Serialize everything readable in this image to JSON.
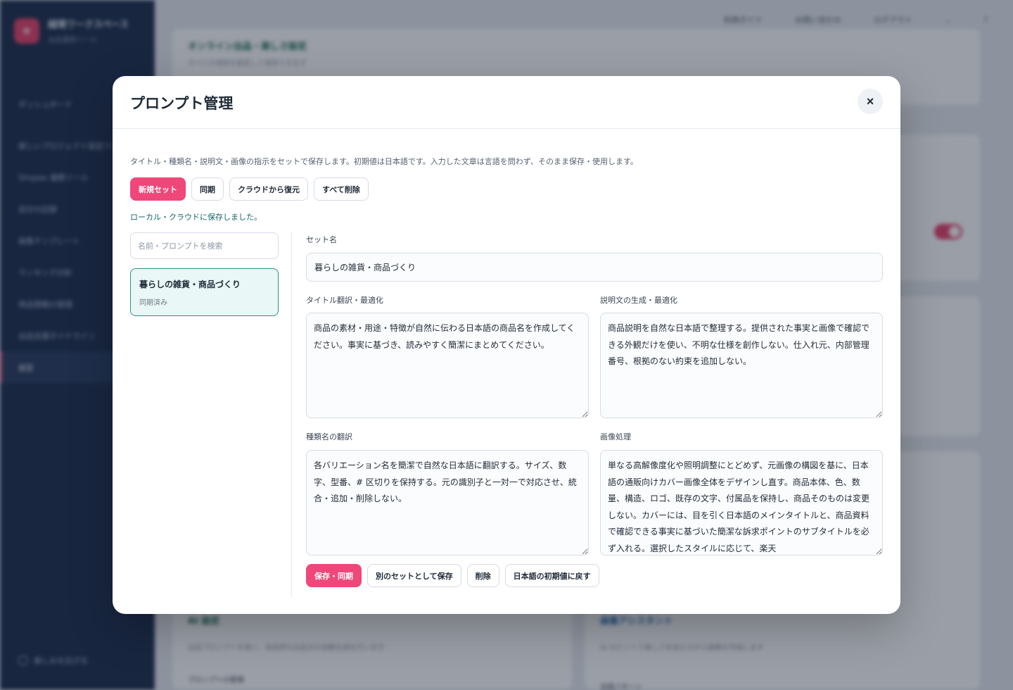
{
  "background": {
    "brand": {
      "logo": "e",
      "title": "越境ワークスペース",
      "subtitle": "出品運用ツール"
    },
    "nav": [
      "ダッシュボード",
      "楽しいプロジェクト設定ツール",
      "Shopee 連携ツール",
      "自分の記録",
      "画像テンプレート",
      "ランキング分析",
      "商品情報の管理",
      "出品支援ガイドライン",
      "設定"
    ],
    "nav_active_index": 8,
    "footer": "楽しみを広げる",
    "topbar": [
      "利用ガイド",
      "お問い合わせ",
      "ログアウト",
      "⌄",
      "?"
    ],
    "cards": [
      {
        "title": "オンライン出品・楽しさ設定",
        "subtitle": "すべての項目を設定して保存できます"
      },
      {
        "title": "AI 設定",
        "subtitle": "出品プロンプトを使い、高品質な出品文の自動生成を行います"
      },
      {
        "title": "画像アシスタント",
        "subtitle": "AI のヒントで楽しさを加えながら画像を作成します"
      }
    ],
    "extra_text": [
      "プロンプトの管理",
      "言語パターン"
    ]
  },
  "modal": {
    "title": "プロンプト管理",
    "close_icon": "×",
    "description": "タイトル・種類名・説明文・画像の指示をセットで保存します。初期値は日本語です。入力した文章は言語を問わず、そのまま保存・使用します。",
    "toolbar": {
      "new_set": "新規セット",
      "sync": "同期",
      "restore": "クラウドから復元",
      "delete_all": "すべて削除"
    },
    "status": "ローカル・クラウドに保存しました。",
    "search": {
      "placeholder": "名前・プロンプトを検索"
    },
    "sets": [
      {
        "name": "暮らしの雑貨・商品づくり",
        "status": "同期済み"
      }
    ],
    "editor": {
      "set_name_label": "セット名",
      "set_name_value": "暮らしの雑貨・商品づくり",
      "title_label": "タイトル翻訳・最適化",
      "title_value": "商品の素材・用途・特徴が自然に伝わる日本語の商品名を作成してください。事実に基づき、読みやすく簡潔にまとめてください。",
      "desc_label": "説明文の生成・最適化",
      "desc_value": "商品説明を自然な日本語で整理する。提供された事実と画像で確認できる外観だけを使い、不明な仕様を創作しない。仕入れ元、内部管理番号、根拠のない約束を追加しない。",
      "variant_label": "種類名の翻訳",
      "variant_value": "各バリエーション名を簡潔で自然な日本語に翻訳する。サイズ、数字、型番、# 区切りを保持する。元の識別子と一対一で対応させ、統合・追加・削除しない。",
      "image_label": "画像処理",
      "image_value": "単なる高解像度化や照明調整にとどめず、元画像の構図を基に、日本語の通販向けカバー画像全体をデザインし直す。商品本体、色、数量、構造、ロゴ、既存の文字、付属品を保持し、商品そのものは変更しない。カバーには、目を引く日本語のメインタイトルと、商品資料で確認できる事実に基づいた簡潔な訴求ポイントのサブタイトルを必ず入れる。選択したスタイルに応じて、楽天"
    },
    "actions": {
      "save_sync": "保存・同期",
      "save_as": "別のセットとして保存",
      "delete": "削除",
      "reset": "日本語の初期値に戻す"
    }
  }
}
